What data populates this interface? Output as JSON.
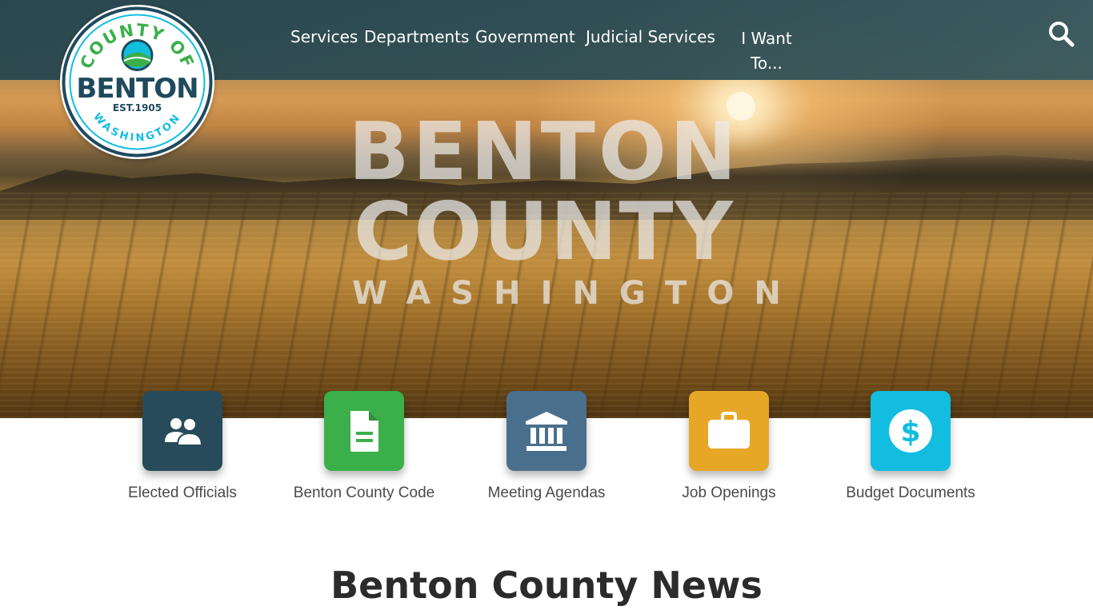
{
  "logo": {
    "top_text": "COUNTY OF",
    "main_text": "BENTON",
    "est_text": "EST.1905",
    "bottom_text": "WASHINGTON"
  },
  "nav": {
    "items": [
      {
        "label": "Services"
      },
      {
        "label": "Departments"
      },
      {
        "label": "Government"
      },
      {
        "label": "Judicial Services"
      },
      {
        "label": "I Want To..."
      }
    ],
    "search_icon": "search-icon"
  },
  "hero": {
    "line1": "BENTON",
    "line2": "COUNTY",
    "line3": "WASHINGTON"
  },
  "quick_links": [
    {
      "label": "Elected Officials",
      "icon": "people-icon",
      "color": "#274b5a"
    },
    {
      "label": "Benton County Code",
      "icon": "document-icon",
      "color": "#3aaf4a"
    },
    {
      "label": "Meeting Agendas",
      "icon": "government-building-icon",
      "color": "#4a6f8d"
    },
    {
      "label": "Job Openings",
      "icon": "briefcase-icon",
      "color": "#e6a626"
    },
    {
      "label": "Budget Documents",
      "icon": "dollar-icon",
      "color": "#12bde0"
    }
  ],
  "news": {
    "title": "Benton County News"
  },
  "colors": {
    "topbar": "#2f4e55",
    "logo_navy": "#1f4a5e",
    "logo_green": "#3aaf4a",
    "logo_cyan": "#12bde0"
  }
}
